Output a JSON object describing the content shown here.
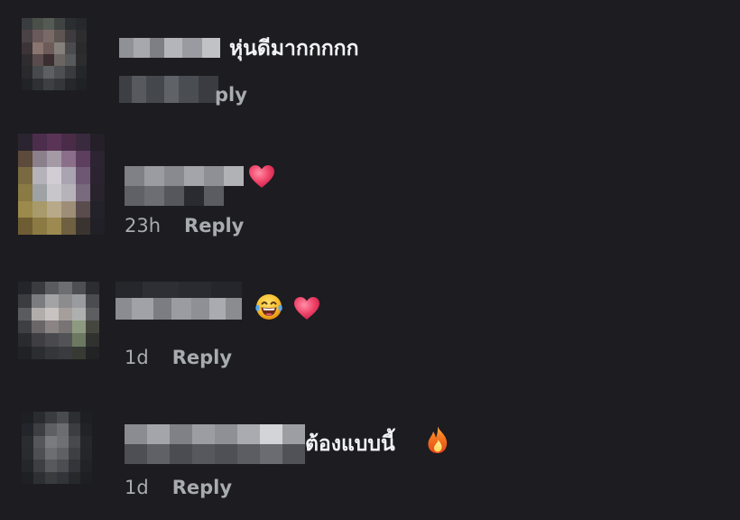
{
  "comments": [
    {
      "text": "หุ่นดีมากกกกก",
      "time": "",
      "reply_label": "ply",
      "reactions": []
    },
    {
      "text": "",
      "time": "23h",
      "reply_label": "Reply",
      "reactions": [
        "heart-emoji"
      ]
    },
    {
      "text": "",
      "time": "1d",
      "reply_label": "Reply",
      "reactions": [
        "laughing-tears-emoji",
        "heart-emoji"
      ]
    },
    {
      "text": "ต้องแบบนี้",
      "time": "1d",
      "reply_label": "Reply",
      "reactions": [
        "fire-emoji"
      ]
    }
  ],
  "colors": {
    "background": "#1c1c21",
    "text_primary": "#f0f2f5",
    "text_secondary": "#a8abb0",
    "heart": "#e8335a",
    "fire": "#f26a1b"
  }
}
